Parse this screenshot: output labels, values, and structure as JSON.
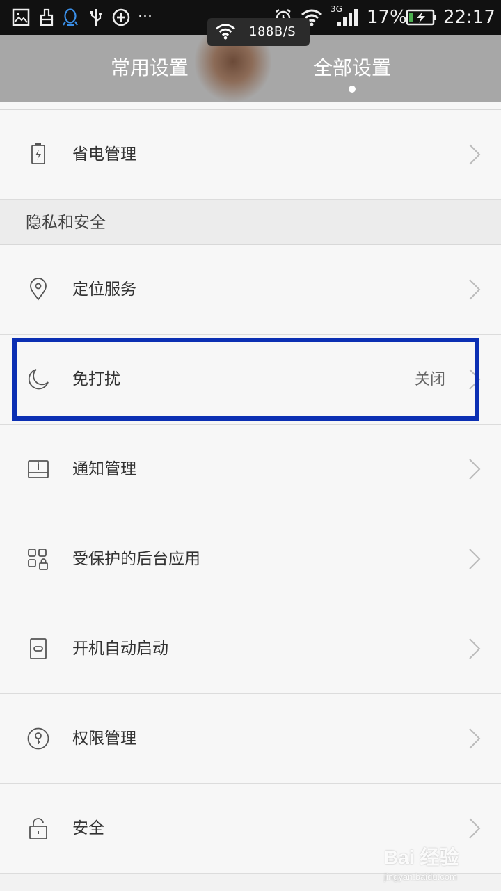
{
  "status_bar": {
    "battery_percent": "17%",
    "time": "22:17",
    "network_type": "3G",
    "overflow": "···",
    "net_speed": "188B/S"
  },
  "header": {
    "tabs": [
      {
        "label": "常用设置",
        "active": false
      },
      {
        "label": "全部设置",
        "active": true
      }
    ]
  },
  "list": {
    "power": {
      "label": "省电管理",
      "icon": "battery-icon"
    },
    "section_privacy": "隐私和安全",
    "location": {
      "label": "定位服务",
      "icon": "location-pin-icon"
    },
    "dnd": {
      "label": "免打扰",
      "value": "关闭",
      "icon": "moon-icon"
    },
    "notify": {
      "label": "通知管理",
      "icon": "notification-icon"
    },
    "protected": {
      "label": "受保护的后台应用",
      "icon": "protected-apps-icon"
    },
    "autostart": {
      "label": "开机自动启动",
      "icon": "autostart-icon"
    },
    "permission": {
      "label": "权限管理",
      "icon": "key-icon"
    },
    "security": {
      "label": "安全",
      "icon": "lock-icon"
    }
  },
  "watermark": {
    "main": "Bai 经验",
    "sub": "jingyan.baidu.com"
  },
  "colors": {
    "highlight": "#0b2fb3",
    "header_bg": "#a7a7a7"
  }
}
